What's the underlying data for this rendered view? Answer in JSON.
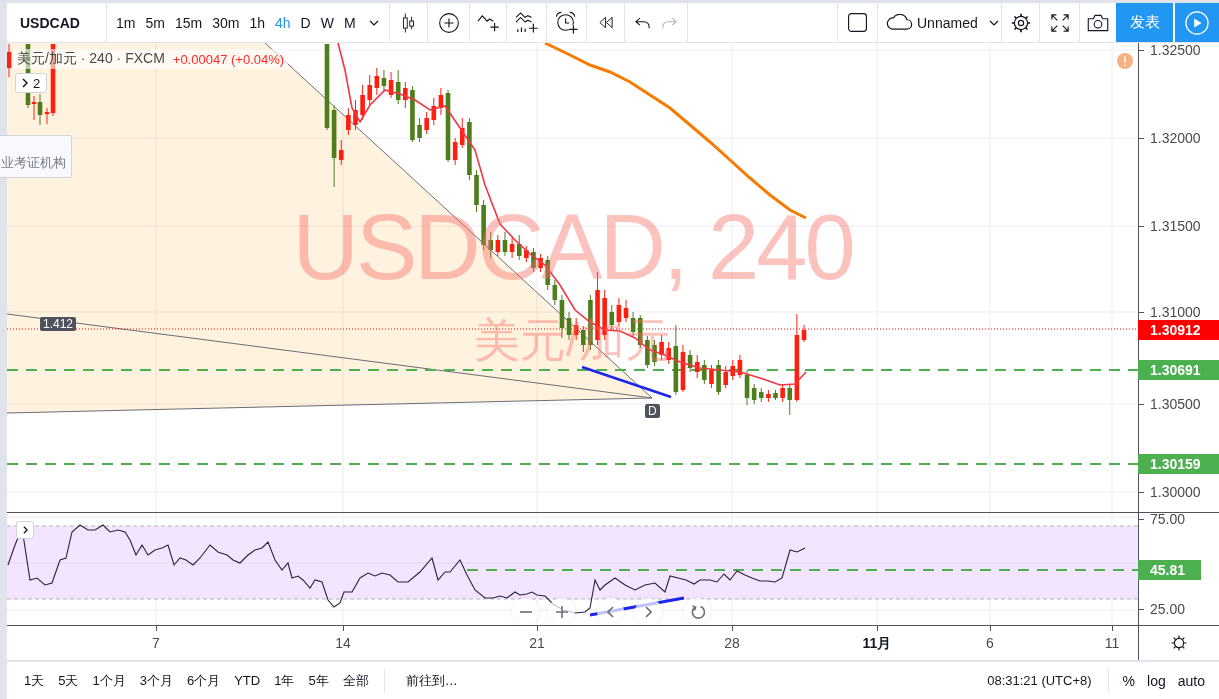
{
  "toolbar": {
    "symbol": "USDCAD",
    "intervals": [
      {
        "label": "1m",
        "selected": false
      },
      {
        "label": "5m",
        "selected": false
      },
      {
        "label": "15m",
        "selected": false
      },
      {
        "label": "30m",
        "selected": false
      },
      {
        "label": "1h",
        "selected": false
      },
      {
        "label": "4h",
        "selected": true
      },
      {
        "label": "D",
        "selected": false
      },
      {
        "label": "W",
        "selected": false
      },
      {
        "label": "M",
        "selected": false
      }
    ],
    "layout_name": "Unnamed",
    "publish_button": "发表"
  },
  "legend": {
    "title": "美元/加元 · 240 · FXCM",
    "change": "+0.00047 (+0.04%)",
    "indicator_count": "2"
  },
  "popup": {
    "text": "业考证机构"
  },
  "watermark": {
    "line_1": "USDCAD, 240",
    "line_2": "美元/加元"
  },
  "drawing_labels": {
    "fan_level": "1.412",
    "point": "D"
  },
  "price_axis": {
    "ticks": [
      "1.32500",
      "1.32000",
      "1.31500",
      "1.31000",
      "1.30500",
      "1.30000"
    ],
    "badges": [
      {
        "kind": "price",
        "text": "1.30912",
        "color": "#ff0000"
      },
      {
        "kind": "level",
        "text": "1.30691",
        "color": "#4caf50"
      },
      {
        "kind": "level",
        "text": "1.30159",
        "color": "#4caf50"
      }
    ]
  },
  "rsi_axis": {
    "ticks": [
      "75.00",
      "25.00"
    ],
    "badges": [
      {
        "kind": "level",
        "text": "45.81",
        "color": "#4caf50"
      }
    ]
  },
  "time_axis": {
    "ticks": [
      {
        "label": "7",
        "kind": "day"
      },
      {
        "label": "14",
        "kind": "day"
      },
      {
        "label": "21",
        "kind": "day"
      },
      {
        "label": "28",
        "kind": "day"
      },
      {
        "label": "11月",
        "kind": "month"
      },
      {
        "label": "6",
        "kind": "day"
      },
      {
        "label": "11",
        "kind": "day"
      }
    ]
  },
  "bottom_bar": {
    "ranges": [
      "1天",
      "5天",
      "1个月",
      "3个月",
      "6个月",
      "YTD",
      "1年",
      "5年",
      "全部"
    ],
    "goto": "前往到…",
    "clock": "08:31:21 (UTC+8)",
    "scale_options": [
      "%",
      "log",
      "auto"
    ]
  }
}
